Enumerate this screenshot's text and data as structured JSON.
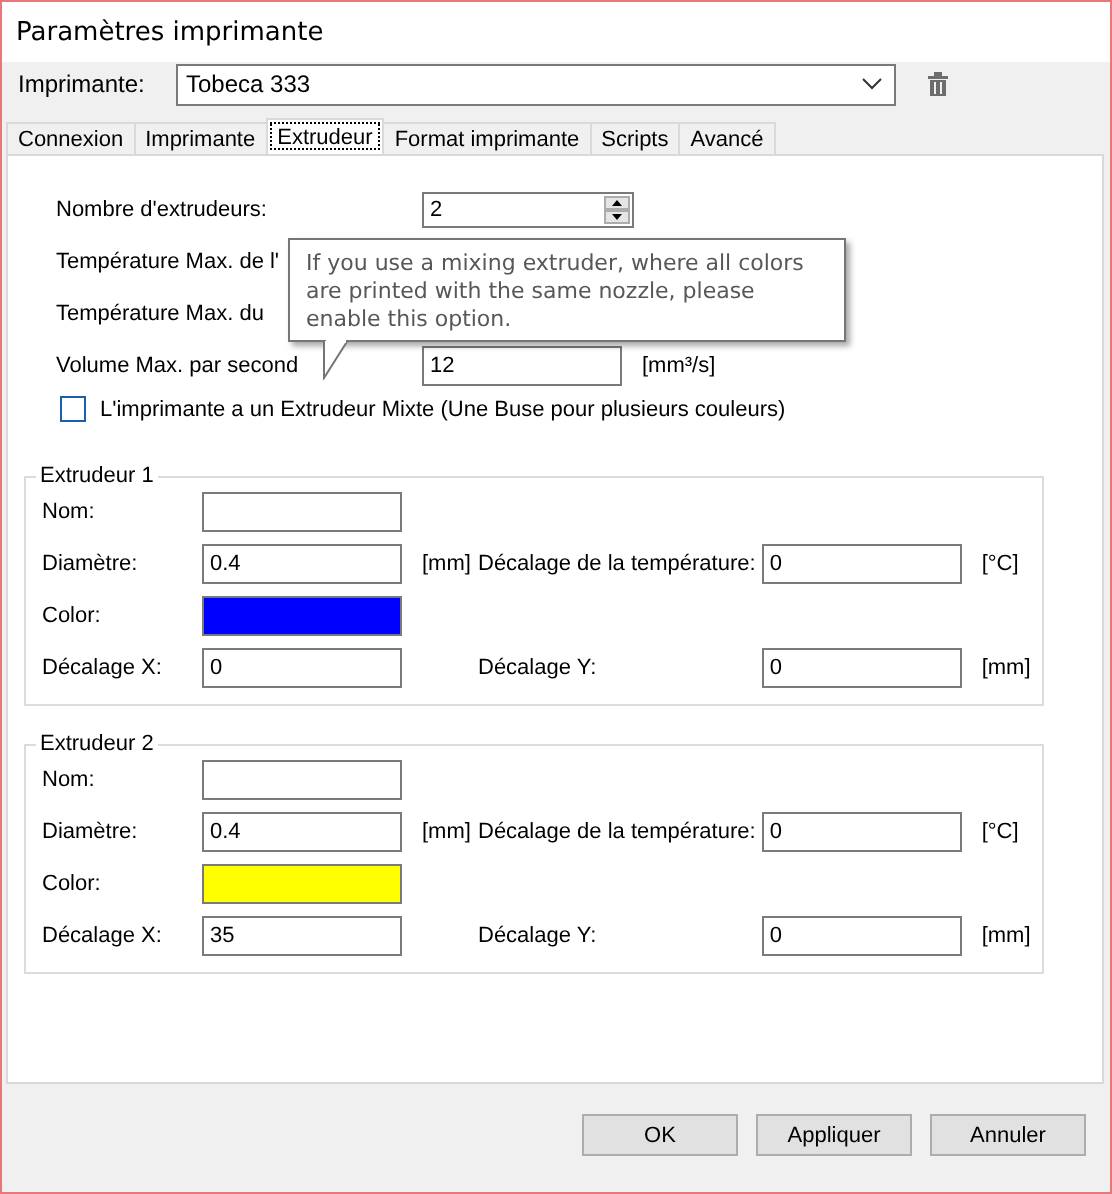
{
  "window": {
    "title": "Paramètres imprimante"
  },
  "printer": {
    "label": "Imprimante:",
    "value": "Tobeca 333"
  },
  "tabs": [
    {
      "label": "Connexion",
      "selected": false
    },
    {
      "label": "Imprimante",
      "selected": false
    },
    {
      "label": "Extrudeur",
      "selected": true
    },
    {
      "label": "Format imprimante",
      "selected": false
    },
    {
      "label": "Scripts",
      "selected": false
    },
    {
      "label": "Avancé",
      "selected": false
    }
  ],
  "settings": [
    {
      "kind": "spin",
      "label": "Nombre d'extrudeurs:",
      "value": "2"
    },
    {
      "kind": "label",
      "label": "Température Max. de l'"
    },
    {
      "kind": "label",
      "label": "Température Max. du"
    },
    {
      "kind": "field",
      "label": "Volume Max. par second",
      "value": "12",
      "unit": "[mm³/s]"
    }
  ],
  "mixing_checkbox": {
    "label": "L'imprimante a un Extrudeur Mixte (Une Buse pour plusieurs couleurs)",
    "checked": false
  },
  "tooltip": {
    "text": "If you use a mixing extruder, where all colors are printed with the same nozzle, please enable this option."
  },
  "extruders": [
    {
      "title": "Extrudeur 1",
      "name": {
        "label": "Nom:"
      },
      "diameter": {
        "label": "Diamètre:",
        "value": "0.4",
        "unit": "[mm]"
      },
      "temp_offset": {
        "label": "Décalage de la température:",
        "value": "0",
        "unit": "[°C]"
      },
      "color": {
        "label": "Color:",
        "color": "#0000ff"
      },
      "offset_x": {
        "label": "Décalage X:",
        "value": "0"
      },
      "offset_y": {
        "label": "Décalage Y:",
        "value": "0",
        "unit": "[mm]"
      }
    },
    {
      "title": "Extrudeur 2",
      "name": {
        "label": "Nom:"
      },
      "diameter": {
        "label": "Diamètre:",
        "value": "0.4",
        "unit": "[mm]"
      },
      "temp_offset": {
        "label": "Décalage de la température:",
        "value": "0",
        "unit": "[°C]"
      },
      "color": {
        "label": "Color:",
        "color": "#ffff00"
      },
      "offset_x": {
        "label": "Décalage X:",
        "value": "35"
      },
      "offset_y": {
        "label": "Décalage Y:",
        "value": "0",
        "unit": "[mm]"
      }
    }
  ],
  "buttons": [
    "OK",
    "Appliquer",
    "Annuler"
  ]
}
